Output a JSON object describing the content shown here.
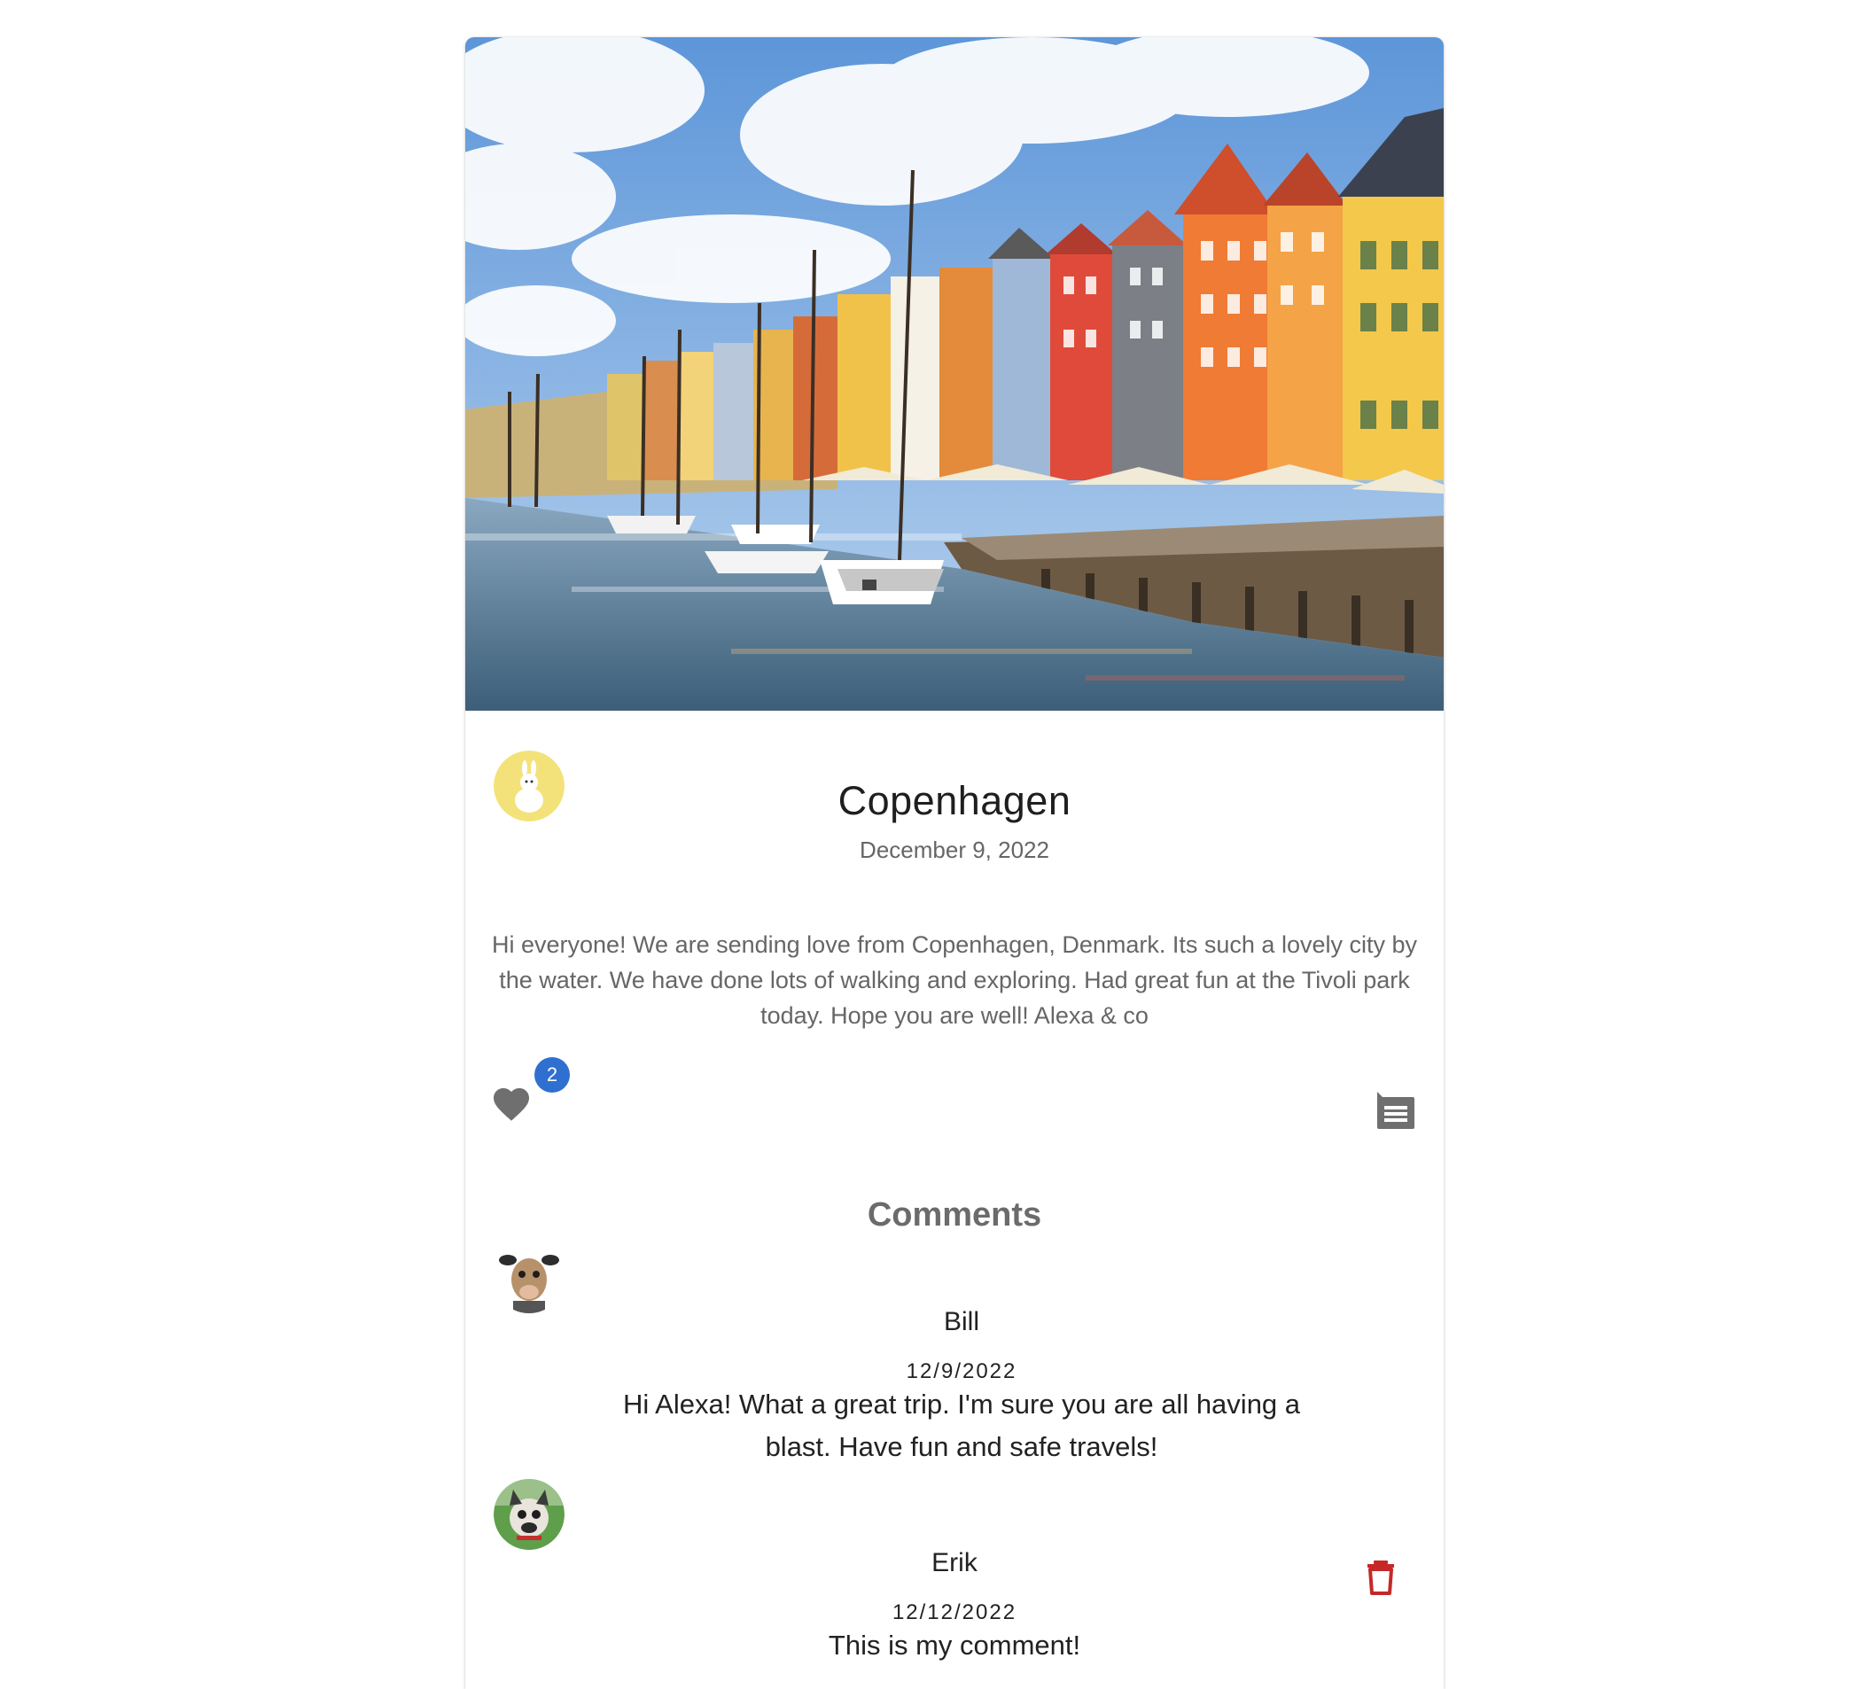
{
  "post": {
    "title": "Copenhagen",
    "date": "December 9, 2022",
    "body": "Hi everyone! We are sending love from Copenhagen, Denmark. Its such a lovely city by the water. We have done lots of walking and exploring. Had great fun at the Tivoli park today. Hope you are well! Alexa & co",
    "like_count": "2"
  },
  "comments_section": {
    "title": "Comments",
    "items": [
      {
        "author": "Bill",
        "date": "12/9/2022",
        "text": "Hi Alexa! What a great trip. I'm sure you are all having a blast. Have fun and safe travels!"
      },
      {
        "author": "Erik",
        "date": "12/12/2022",
        "text": "This is my comment!"
      }
    ]
  },
  "icons": {
    "like": "heart-icon",
    "comment": "comment-icon",
    "delete": "trash-icon"
  },
  "colors": {
    "badge": "#2f6fd0",
    "icon_gray": "#6f6f6f",
    "delete": "#c62828"
  }
}
